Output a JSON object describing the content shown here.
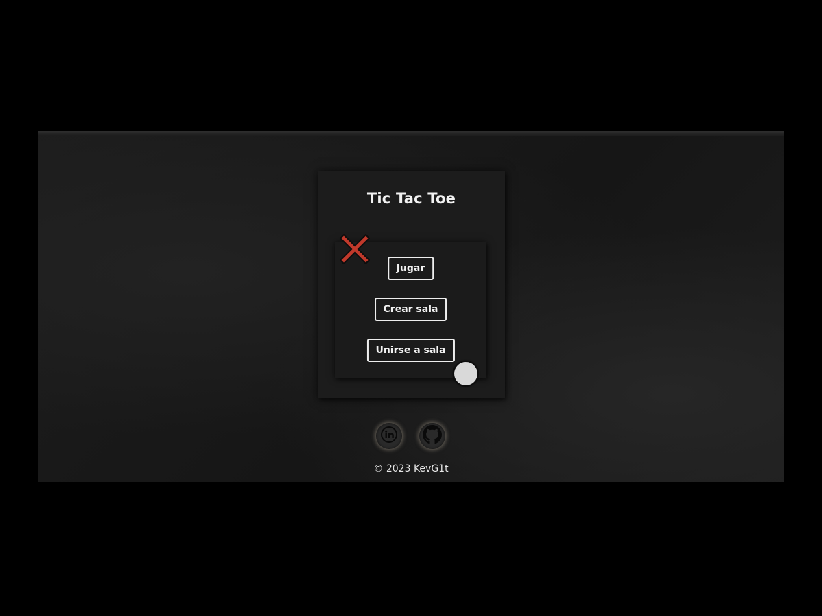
{
  "game": {
    "title": "Tic Tac Toe"
  },
  "menu": {
    "play_label": "Jugar",
    "create_room_label": "Crear sala",
    "join_room_label": "Unirse a sala"
  },
  "decorations": {
    "x_icon": "x-mark-icon",
    "o_icon": "o-mark-icon",
    "x_color": "#c0392b",
    "o_color": "#d9d9d9"
  },
  "social": {
    "links": [
      {
        "name": "linkedin",
        "icon": "linkedin-icon"
      },
      {
        "name": "github",
        "icon": "github-icon"
      }
    ],
    "glow_color": "#968c7d"
  },
  "footer": {
    "copyright": "© 2023 KevG1t"
  }
}
